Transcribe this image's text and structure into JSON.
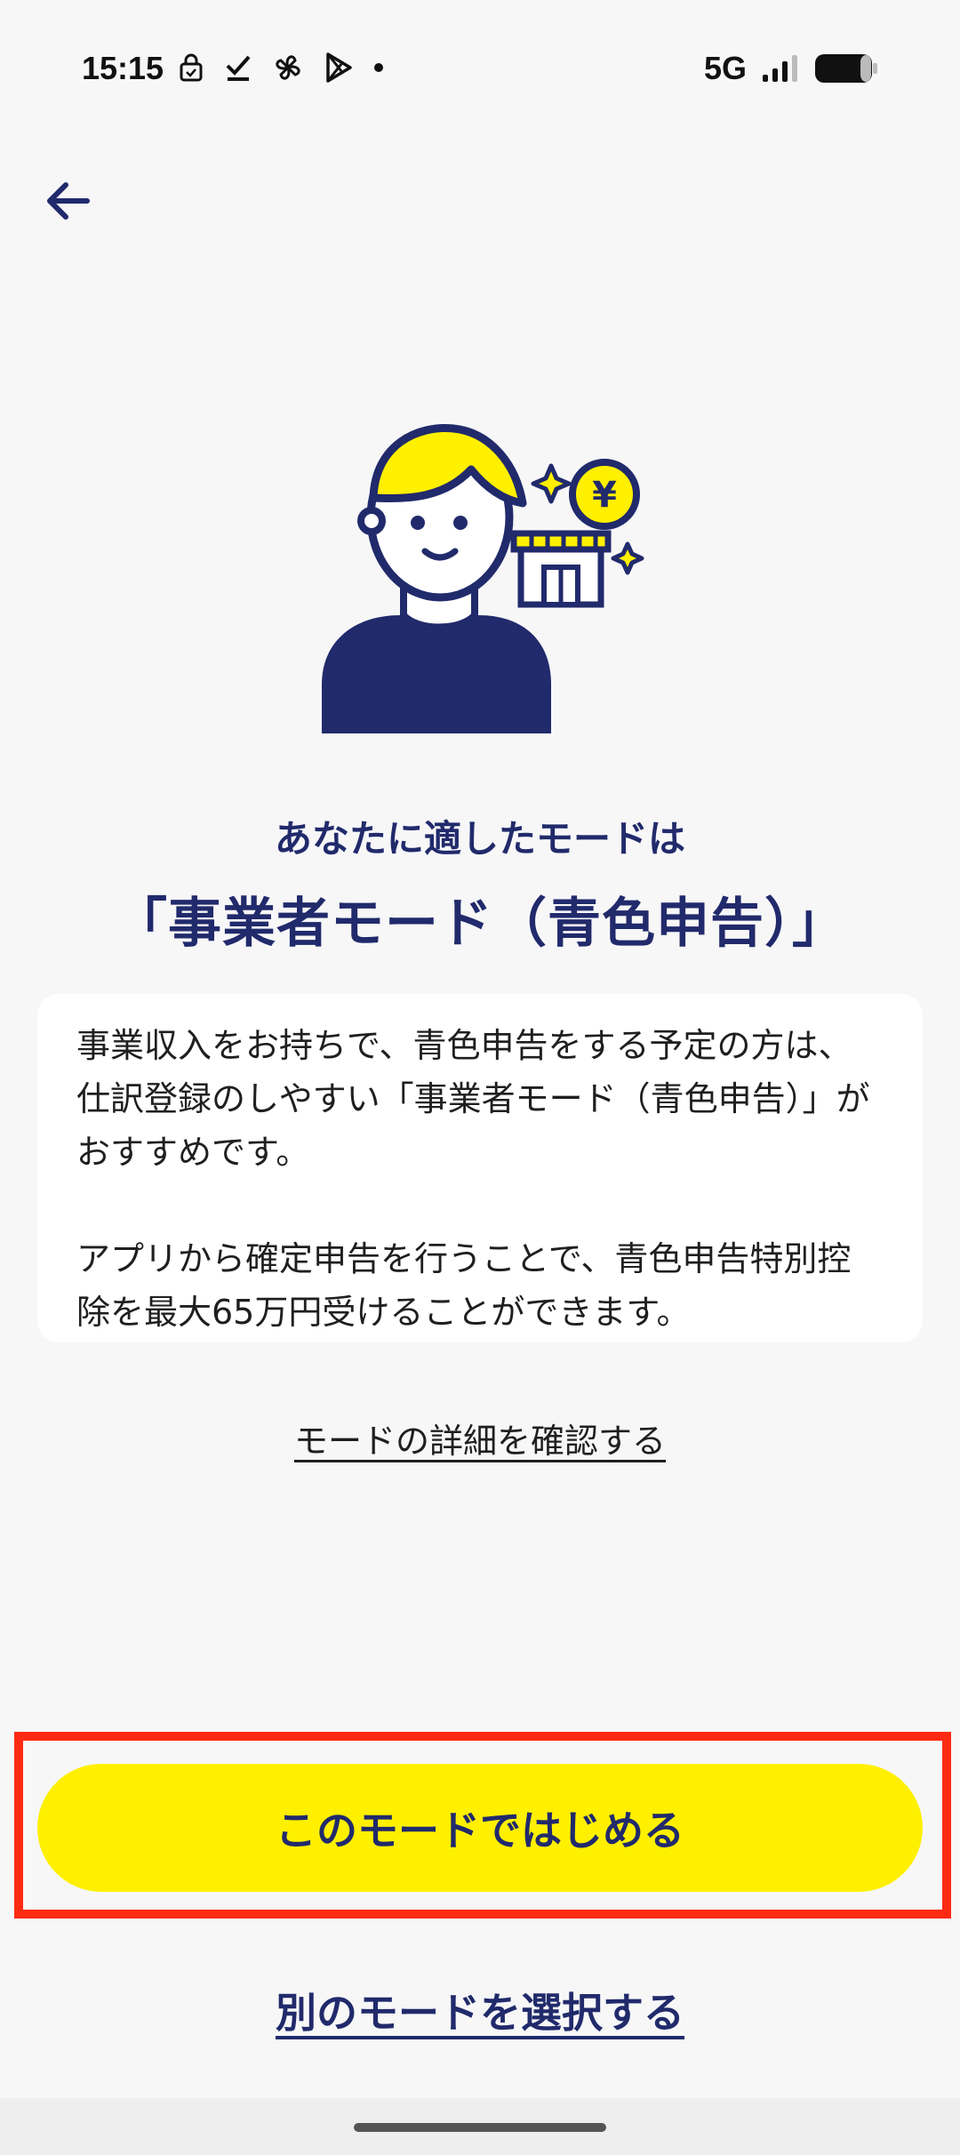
{
  "status_bar": {
    "time": "15:15",
    "network": "5G",
    "icons_left": [
      "lock-icon",
      "check-icon",
      "pinwheel-icon",
      "play-store-icon",
      "dot-icon"
    ],
    "icons_right": [
      "signal-icon",
      "battery-icon"
    ]
  },
  "header": {
    "back_icon": "arrow-left-icon"
  },
  "hero": {
    "illustration": "person-with-shop-illustration",
    "coin_symbol": "¥",
    "colors": {
      "navy": "#212a6b",
      "yellow": "#fff000"
    }
  },
  "main": {
    "subtitle": "あなたに適したモードは",
    "title": "「事業者モード（青色申告）」",
    "description": [
      "事業収入をお持ちで、青色申告をする予定の方は、仕訳登録のしやすい「事業者モード（青色申告）」がおすすめです。",
      "アプリから確定申告を行うことで、青色申告特別控除を最大65万円受けることができます。"
    ],
    "details_link": "モードの詳細を確認する"
  },
  "actions": {
    "primary_label": "このモードではじめる",
    "secondary_label": "別のモードを選択する",
    "highlight_color": "#ff2a12"
  }
}
